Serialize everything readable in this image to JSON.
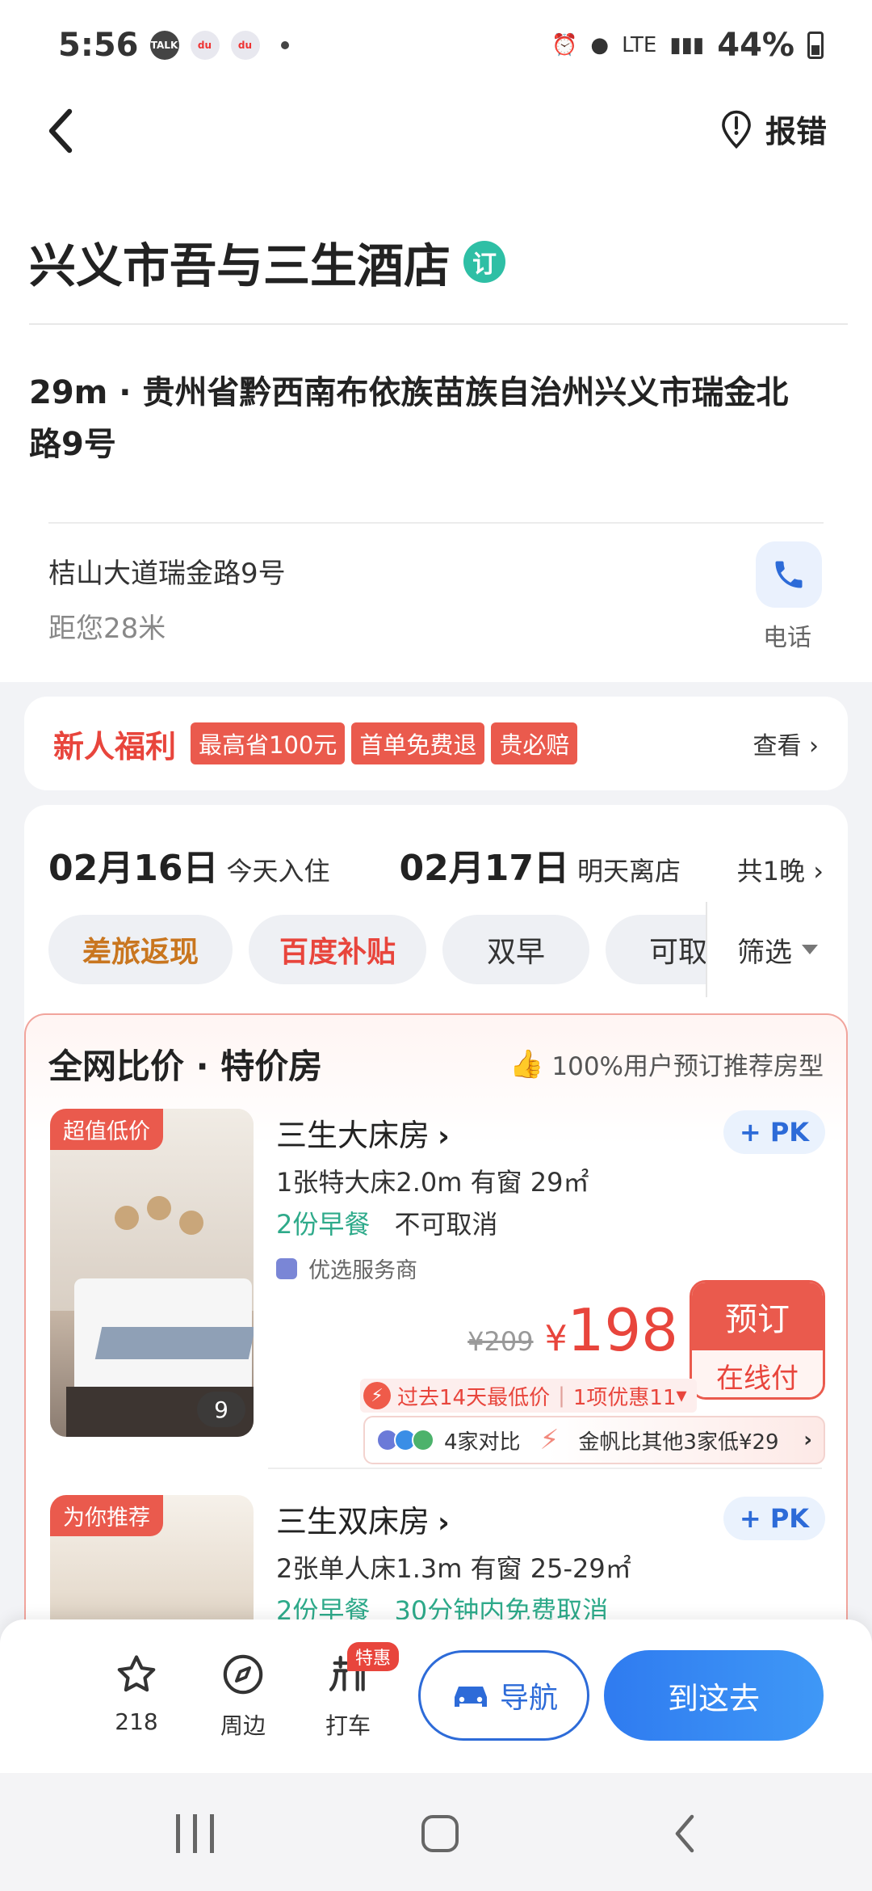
{
  "status_bar": {
    "time": "5:56",
    "icons": [
      "talk-icon",
      "baidu-map-icon",
      "baidu-map-icon"
    ],
    "signal": "LTE",
    "battery": "44%"
  },
  "header": {
    "report_label": "报错"
  },
  "hotel": {
    "name": "兴义市吾与三生酒店",
    "badge": "订",
    "address": "29m · 贵州省黔西南布依族苗族自治州兴义市瑞金北路9号",
    "street": "桔山大道瑞金路9号",
    "distance": "距您28米",
    "phone_label": "电话"
  },
  "benefit": {
    "title": "新人福利",
    "tags": [
      "最高省100元",
      "首单免费退",
      "贵必赔"
    ],
    "more": "查看"
  },
  "stay": {
    "checkin_date": "02月16日",
    "checkin_label": "今天入住",
    "checkout_date": "02月17日",
    "checkout_label": "明天离店",
    "nights": "共1晚"
  },
  "filters": {
    "chips": [
      "差旅返现",
      "百度补贴",
      "双早",
      "可取"
    ],
    "filter_label": "筛选"
  },
  "special": {
    "title": "全网比价 · 特价房",
    "recommend": "100%用户预订推荐房型"
  },
  "rooms": [
    {
      "tag": "超值低价",
      "photo_count": "9",
      "name": "三生大床房",
      "pk": "+ PK",
      "bed": "1张特大床2.0m 有窗 29㎡",
      "meal": "2份早餐",
      "cancel": "不可取消",
      "service": "优选服务商",
      "old_price": "¥209",
      "currency": "¥",
      "price": "198",
      "book": "预订",
      "pay": "在线付",
      "lowest": "过去14天最低价",
      "discount": "1项优惠11",
      "compare_count": "4家对比",
      "compare_note": "金帆比其他3家低¥29"
    },
    {
      "tag": "为你推荐",
      "name": "三生双床房",
      "pk": "+ PK",
      "bed": "2张单人床1.3m 有窗 25-29㎡",
      "meal": "2份早餐",
      "cancel": "30分钟内免费取消"
    }
  ],
  "actions": {
    "favorite_count": "218",
    "nearby": "周边",
    "taxi": "打车",
    "taxi_badge": "特惠",
    "navigate": "导航",
    "go": "到这去"
  },
  "colors": {
    "accent_red": "#e8453c",
    "accent_blue": "#2d6bd8",
    "green": "#2eaa8a"
  }
}
